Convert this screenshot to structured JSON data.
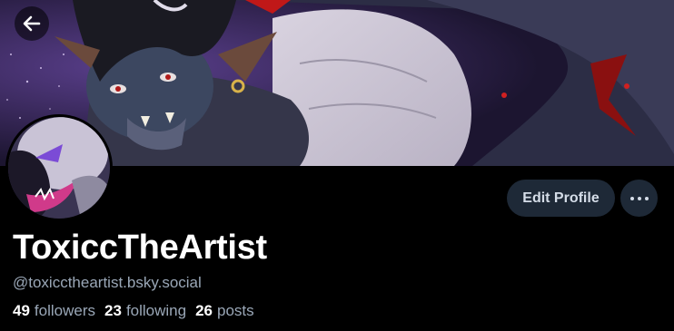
{
  "profile": {
    "display_name": "ToxiccTheArtist",
    "handle": "@toxicctheartist.bsky.social",
    "stats": {
      "followers_count": "49",
      "followers_label": "followers",
      "following_count": "23",
      "following_label": "following",
      "posts_count": "26",
      "posts_label": "posts"
    }
  },
  "actions": {
    "edit_profile_label": "Edit Profile"
  },
  "icons": {
    "back": "arrow-left-icon",
    "more": "ellipsis-icon"
  },
  "colors": {
    "background": "#000000",
    "button_bg": "#1e2937",
    "button_text": "#d5dde8",
    "muted_text": "#9aa7b7"
  }
}
